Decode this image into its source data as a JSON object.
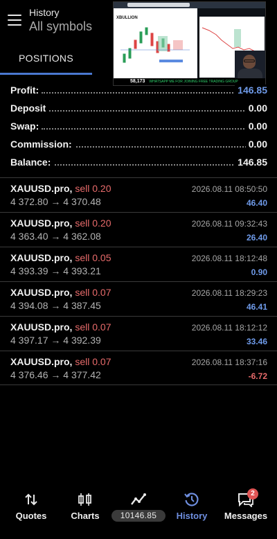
{
  "header": {
    "title": "History",
    "subtitle": "All symbols",
    "tab_label": "POSITIONS"
  },
  "overlay": {
    "logo": "XBULLION",
    "ticker_number": "58,173",
    "ticker_text": "WHATSAPP ME FOR JOINING FREE TRADING GROUP"
  },
  "summary": [
    {
      "label": "Profit:",
      "value": "146.85",
      "highlight": true
    },
    {
      "label": "Deposit",
      "value": "0.00"
    },
    {
      "label": "Swap:",
      "value": "0.00"
    },
    {
      "label": "Commission:",
      "value": "0.00"
    },
    {
      "label": "Balance:",
      "value": "146.85"
    }
  ],
  "deals": [
    {
      "symbol": "XAUUSD.pro,",
      "side": "sell 0.20",
      "prices": "4 372.80 → 4 370.48",
      "time": "2026.08.11 08:50:50",
      "profit": "46.40"
    },
    {
      "symbol": "XAUUSD.pro,",
      "side": "sell 0.20",
      "prices": "4 363.40 → 4 362.08",
      "time": "2026.08.11 09:32:43",
      "profit": "26.40"
    },
    {
      "symbol": "XAUUSD.pro,",
      "side": "sell 0.05",
      "prices": "4 393.39 → 4 393.21",
      "time": "2026.08.11 18:12:48",
      "profit": "0.90"
    },
    {
      "symbol": "XAUUSD.pro,",
      "side": "sell 0.07",
      "prices": "4 394.08 → 4 387.45",
      "time": "2026.08.11 18:29:23",
      "profit": "46.41"
    },
    {
      "symbol": "XAUUSD.pro,",
      "side": "sell 0.07",
      "prices": "4 397.17 → 4 392.39",
      "time": "2026.08.11 18:12:12",
      "profit": "33.46"
    },
    {
      "symbol": "XAUUSD.pro,",
      "side": "sell 0.07",
      "prices": "4 376.46 → 4 377.42",
      "time": "2026.08.11 18:37:16",
      "profit": "-6.72"
    }
  ],
  "nav": {
    "quotes": "Quotes",
    "charts": "Charts",
    "balance": "10146.85",
    "history": "History",
    "messages": "Messages",
    "messages_badge": "2"
  },
  "colors": {
    "accent_blue": "#6f9bea",
    "sell_red": "#e86b6b",
    "active_tab": "#4a78d0"
  }
}
